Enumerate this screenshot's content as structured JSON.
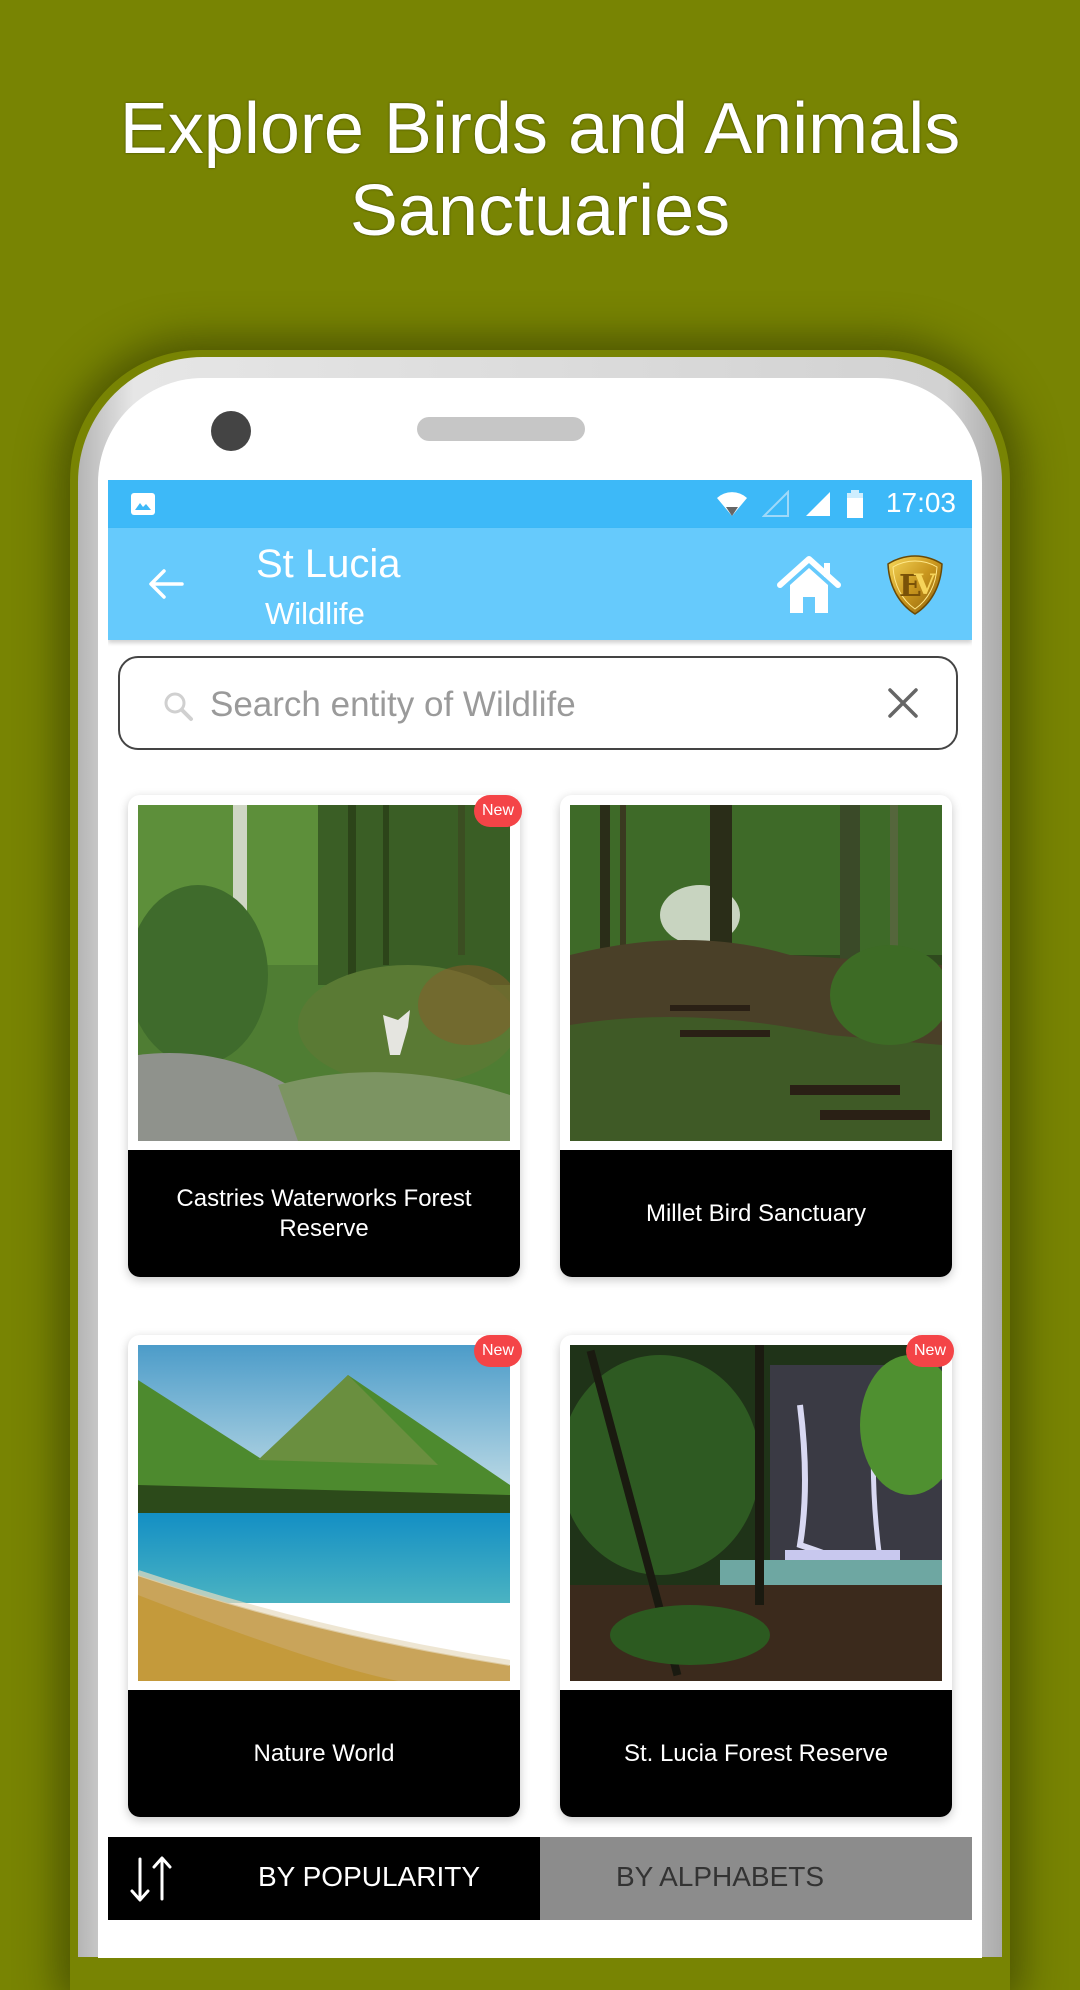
{
  "promo": {
    "headline_line1": "Explore Birds and Animals",
    "headline_line2": "Sanctuaries",
    "background_color": "#788403"
  },
  "status_bar": {
    "time": "17:03",
    "icons": [
      "gallery-notification-icon",
      "wifi-icon",
      "signal-empty-icon",
      "signal-full-icon",
      "battery-icon"
    ],
    "color": "#3DB9F8"
  },
  "app_bar": {
    "title": "St Lucia",
    "subtitle": "Wildlife",
    "color": "#66CAFC",
    "icons": [
      "back-arrow-icon",
      "home-icon",
      "ev-logo-icon"
    ]
  },
  "search": {
    "placeholder": "Search entity of Wildlife",
    "value": ""
  },
  "cards": [
    {
      "title": "Castries Waterworks Forest Reserve",
      "badge": "New",
      "image": "tropical garden path with lush plants"
    },
    {
      "title": "Millet Bird Sanctuary",
      "badge": "",
      "image": "forest trail with steps through trees"
    },
    {
      "title": "Nature World",
      "badge": "New",
      "image": "pitons mountain beach with turquoise sea"
    },
    {
      "title": "St. Lucia Forest Reserve",
      "badge": "New",
      "image": "rainforest waterfall with pool"
    }
  ],
  "badge_color": "#F44447",
  "sort_tabs": {
    "popularity": "BY POPULARITY",
    "alphabets": "BY ALPHABETS",
    "active": "popularity"
  }
}
